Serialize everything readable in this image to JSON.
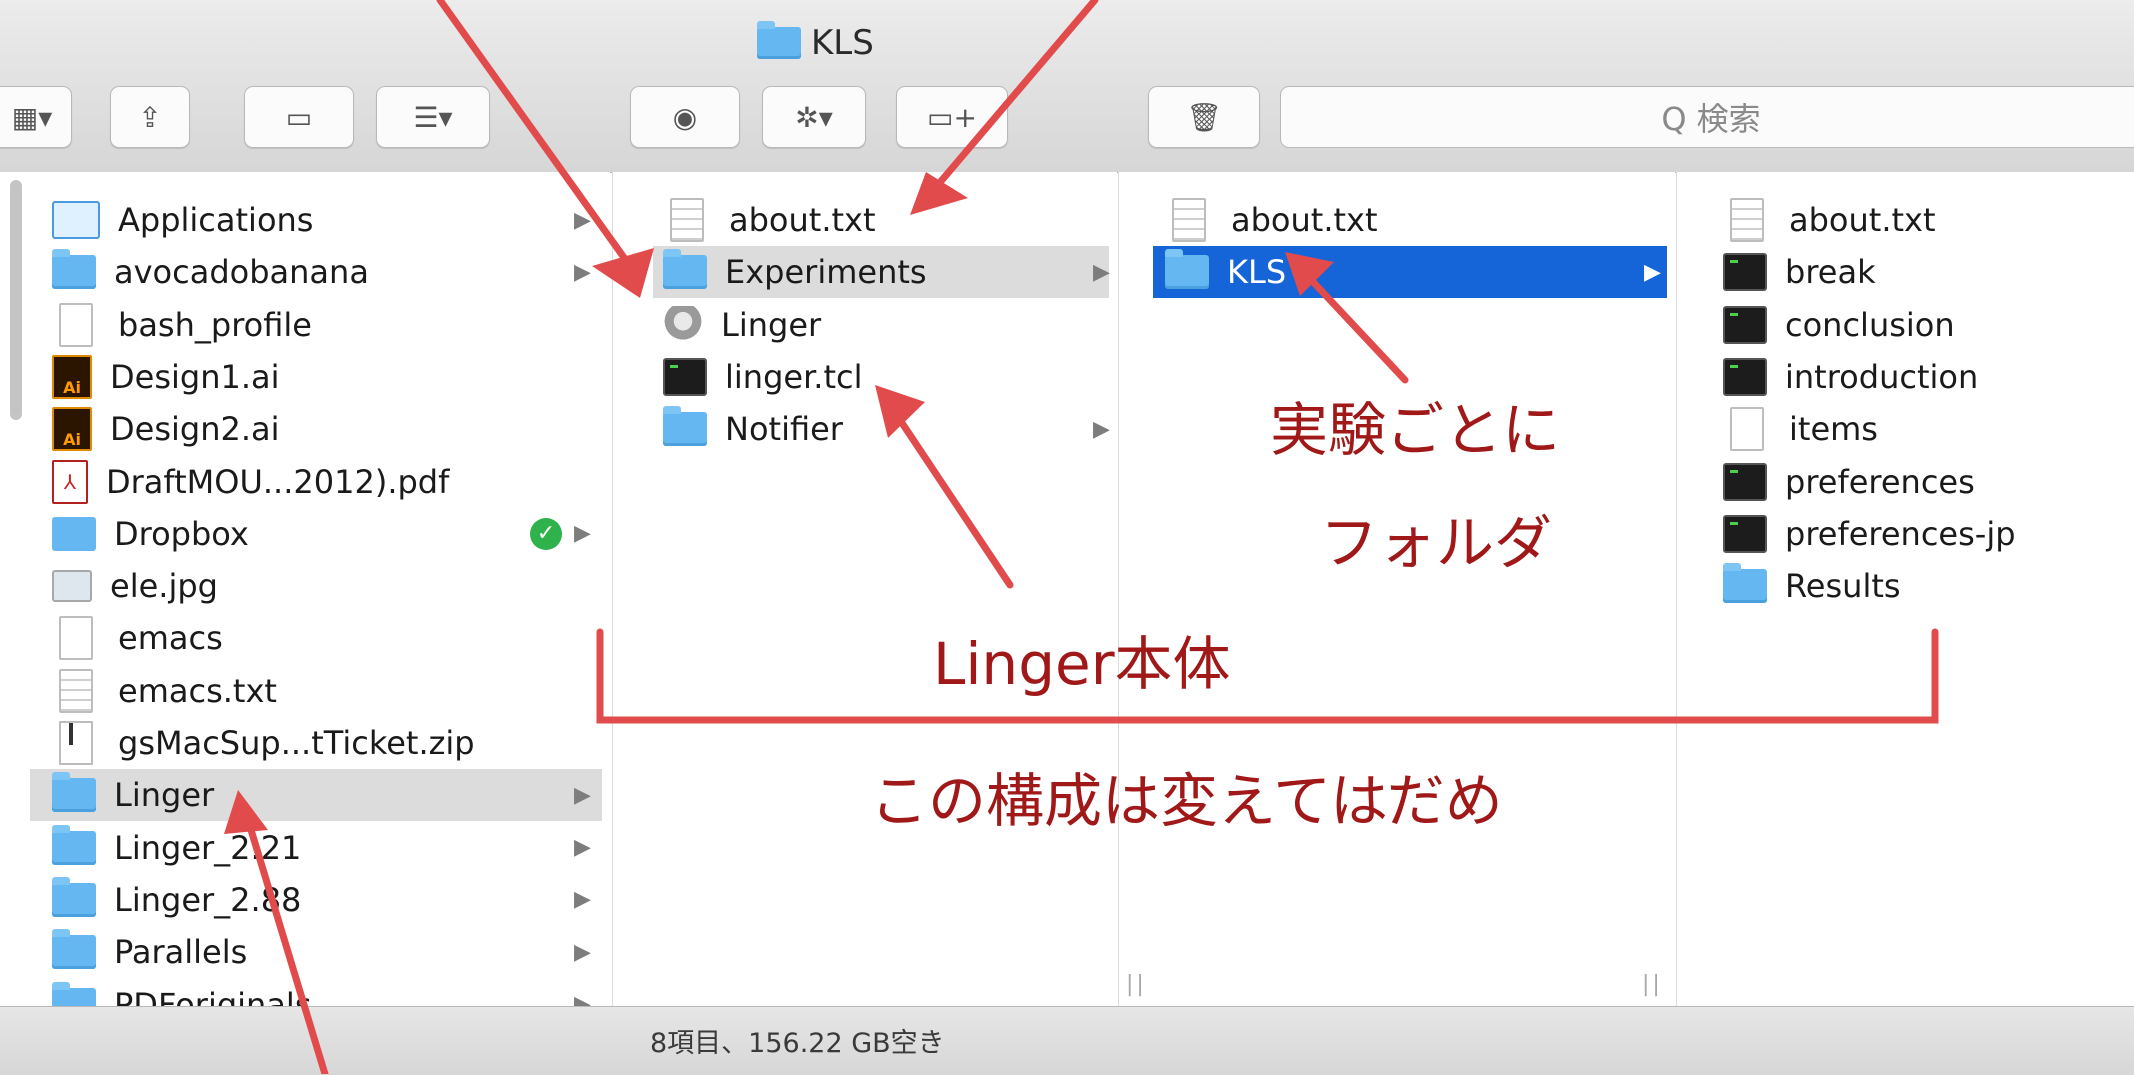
{
  "window": {
    "title": "KLS"
  },
  "toolbar": {
    "view_glyph": "▦▾",
    "share_glyph": "⇪",
    "tag_glyph": "▭",
    "arrange_glyph": "☰▾",
    "quicklook_glyph": "◉",
    "action_glyph": "✲▾",
    "newfolder_glyph": "▭+",
    "trash_glyph": "🗑",
    "search_icon": "magnifier-icon",
    "search_placeholder": "Q 検索"
  },
  "columns": [
    {
      "name": "column-home",
      "items": [
        {
          "label": "Applications",
          "icon": "app-icon",
          "chevron": true
        },
        {
          "label": "avocadobanana",
          "icon": "folder-icon",
          "chevron": true
        },
        {
          "label": "bash_profile",
          "icon": "document-icon",
          "chevron": false
        },
        {
          "label": "Design1.ai",
          "icon": "illustrator-icon",
          "chevron": false
        },
        {
          "label": "Design2.ai",
          "icon": "illustrator-icon",
          "chevron": false
        },
        {
          "label": "DraftMOU...2012).pdf",
          "icon": "pdf-icon",
          "chevron": false
        },
        {
          "label": "Dropbox",
          "icon": "dropbox-icon",
          "chevron": true,
          "badge": "✓"
        },
        {
          "label": "ele.jpg",
          "icon": "image-icon",
          "chevron": false
        },
        {
          "label": "emacs",
          "icon": "document-icon",
          "chevron": false
        },
        {
          "label": "emacs.txt",
          "icon": "text-document-icon",
          "chevron": false
        },
        {
          "label": "gsMacSup...tTicket.zip",
          "icon": "zip-icon",
          "chevron": false
        },
        {
          "label": "Linger",
          "icon": "folder-icon",
          "chevron": true,
          "selected": "grey"
        },
        {
          "label": "Linger_2.21",
          "icon": "folder-icon",
          "chevron": true
        },
        {
          "label": "Linger_2.88",
          "icon": "folder-icon",
          "chevron": true
        },
        {
          "label": "Parallels",
          "icon": "folder-icon",
          "chevron": true
        },
        {
          "label": "PDForiginals",
          "icon": "folder-icon",
          "chevron": true
        }
      ]
    },
    {
      "name": "column-linger",
      "items": [
        {
          "label": "about.txt",
          "icon": "text-document-icon",
          "chevron": false
        },
        {
          "label": "Experiments",
          "icon": "folder-icon",
          "chevron": true,
          "selected": "grey"
        },
        {
          "label": "Linger",
          "icon": "linger-app-icon",
          "chevron": false
        },
        {
          "label": "linger.tcl",
          "icon": "terminal-icon",
          "chevron": false
        },
        {
          "label": "Notifier",
          "icon": "folder-icon",
          "chevron": true
        }
      ]
    },
    {
      "name": "column-experiments",
      "items": [
        {
          "label": "about.txt",
          "icon": "text-document-icon",
          "chevron": false
        },
        {
          "label": "KLS",
          "icon": "folder-icon",
          "chevron": true,
          "selected": "blue"
        }
      ]
    },
    {
      "name": "column-kls",
      "items": [
        {
          "label": "about.txt",
          "icon": "text-document-icon",
          "chevron": false
        },
        {
          "label": "break",
          "icon": "terminal-icon",
          "chevron": false
        },
        {
          "label": "conclusion",
          "icon": "terminal-icon",
          "chevron": false
        },
        {
          "label": "introduction",
          "icon": "terminal-icon",
          "chevron": false
        },
        {
          "label": "items",
          "icon": "document-icon",
          "chevron": false
        },
        {
          "label": "preferences",
          "icon": "terminal-icon",
          "chevron": false
        },
        {
          "label": "preferences-jp",
          "icon": "terminal-icon",
          "chevron": false
        },
        {
          "label": "Results",
          "icon": "folder-icon",
          "chevron": false
        }
      ]
    }
  ],
  "status": {
    "text": "8項目、156.22 GB空き"
  },
  "annotations": {
    "experiment_folder_line1": "実験ごとに",
    "experiment_folder_line2": "フォルダ",
    "linger_body": "Linger本体",
    "structure_note": "この構成は変えてはだめ",
    "color": "#a01818"
  }
}
